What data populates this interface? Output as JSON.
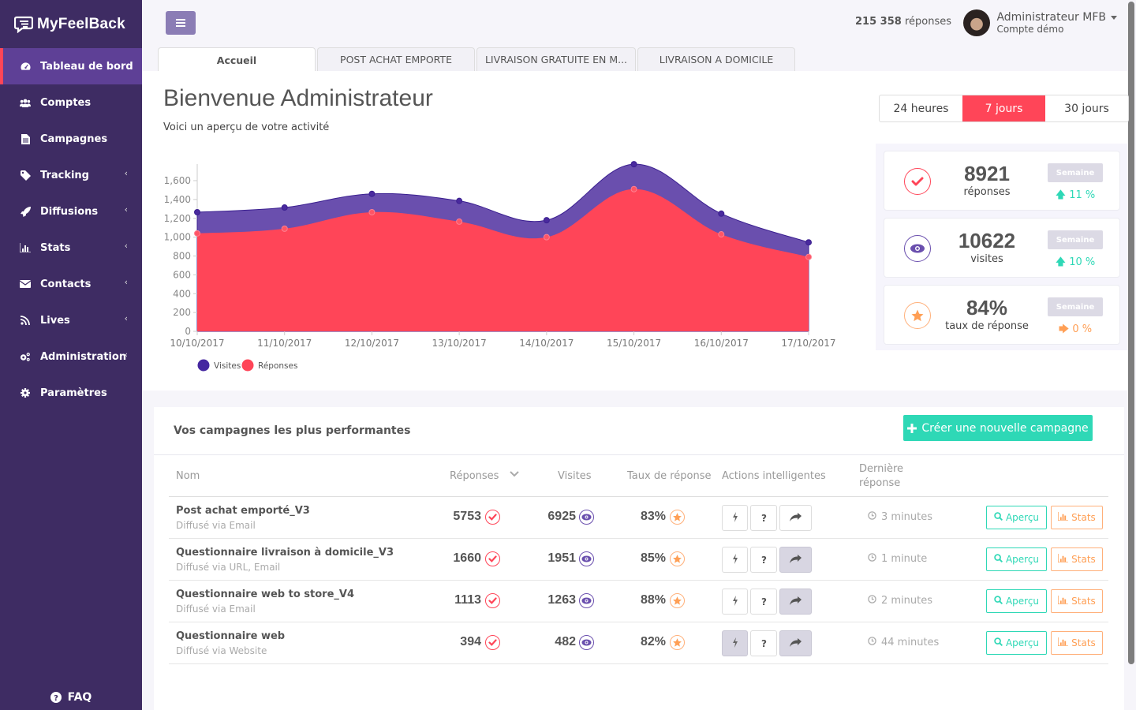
{
  "app": {
    "brand": "MyFeelBack"
  },
  "sidebar": {
    "items": [
      {
        "label": "Tableau de bord",
        "icon": "dashboard-icon",
        "active": true,
        "has_submenu": false
      },
      {
        "label": "Comptes",
        "icon": "users-icon",
        "has_submenu": false
      },
      {
        "label": "Campagnes",
        "icon": "file-icon",
        "has_submenu": false
      },
      {
        "label": "Tracking",
        "icon": "tag-icon",
        "has_submenu": true
      },
      {
        "label": "Diffusions",
        "icon": "rocket-icon",
        "has_submenu": true
      },
      {
        "label": "Stats",
        "icon": "bar-chart-icon",
        "has_submenu": true
      },
      {
        "label": "Contacts",
        "icon": "envelope-icon",
        "has_submenu": true
      },
      {
        "label": "Lives",
        "icon": "rss-icon",
        "has_submenu": true
      },
      {
        "label": "Administration",
        "icon": "cogs-icon",
        "has_submenu": true
      },
      {
        "label": "Paramètres",
        "icon": "gear-icon",
        "has_submenu": false
      }
    ],
    "chevron": "‹",
    "faq_label": "FAQ"
  },
  "header": {
    "responses_count": "215 358",
    "responses_label": "réponses",
    "user_name": "Administrateur MFB",
    "user_account": "Compte démo"
  },
  "tabs": [
    {
      "label": "Accueil",
      "active": true
    },
    {
      "label": "POST ACHAT EMPORTE"
    },
    {
      "label": "LIVRAISON GRATUITE EN M..."
    },
    {
      "label": "LIVRAISON A DOMICILE"
    }
  ],
  "welcome": {
    "title": "Bienvenue Administrateur",
    "subtitle": "Voici un aperçu de votre activité"
  },
  "period": {
    "options": [
      "24 heures",
      "7 jours",
      "30 jours"
    ],
    "selected": "7 jours"
  },
  "kpis": [
    {
      "value": "8921",
      "label": "réponses",
      "badge": "Semaine",
      "trend": "11 %",
      "trend_dir": "up",
      "icon": "check-circle-icon"
    },
    {
      "value": "10622",
      "label": "visites",
      "badge": "Semaine",
      "trend": "10 %",
      "trend_dir": "up",
      "icon": "eye-icon"
    },
    {
      "value": "84%",
      "label": "taux de réponse",
      "badge": "Semaine",
      "trend": "0 %",
      "trend_dir": "right",
      "icon": "star-icon"
    }
  ],
  "colors": {
    "accent": "#ff4558",
    "sidebar": "#3e2c63",
    "sidebar_active": "#5e4096",
    "visits": "#6a4fae",
    "responses": "#ff4558",
    "teal": "#2ed8b6",
    "orange": "#ff9f55"
  },
  "chart_data": {
    "type": "area",
    "categories": [
      "10/10/2017",
      "11/10/2017",
      "12/10/2017",
      "13/10/2017",
      "14/10/2017",
      "15/10/2017",
      "16/10/2017",
      "17/10/2017"
    ],
    "series": [
      {
        "name": "Visites",
        "color": "#6a4fae",
        "values": [
          1265,
          1315,
          1460,
          1385,
          1180,
          1775,
          1250,
          945
        ]
      },
      {
        "name": "Réponses",
        "color": "#ff4558",
        "values": [
          1040,
          1090,
          1265,
          1165,
          1000,
          1510,
          1030,
          790
        ]
      }
    ],
    "yticks": [
      0,
      200,
      400,
      600,
      800,
      1000,
      1200,
      1400,
      1600
    ],
    "ytick_labels": [
      "0",
      "200",
      "400",
      "600",
      "800",
      "1,000",
      "1,200",
      "1,400",
      "1,600"
    ],
    "ylim": [
      0,
      1760
    ],
    "legend": [
      "Visites",
      "Réponses"
    ],
    "legend_position": "bottom-left",
    "grid": false,
    "title": "",
    "xlabel": "",
    "ylabel": ""
  },
  "campaigns": {
    "title": "Vos campagnes les plus performantes",
    "create_label": "Créer une nouvelle campagne",
    "columns": {
      "name": "Nom",
      "responses": "Réponses",
      "visits": "Visites",
      "rate": "Taux de réponse",
      "actions": "Actions intelligentes",
      "last_line1": "Dernière",
      "last_line2": "réponse"
    },
    "preview_label": "Aperçu",
    "stats_label": "Stats",
    "rows": [
      {
        "name": "Post achat emporté_V3",
        "via": "Diffusé via Email",
        "responses": "5753",
        "visits": "6925",
        "rate": "83%",
        "last": "3 minutes",
        "actions_on": [
          false,
          false,
          false
        ]
      },
      {
        "name": "Questionnaire livraison à domicile_V3",
        "via": "Diffusé via URL, Email",
        "responses": "1660",
        "visits": "1951",
        "rate": "85%",
        "last": "1 minute",
        "actions_on": [
          false,
          false,
          true
        ]
      },
      {
        "name": "Questionnaire web to store_V4",
        "via": "Diffusé via Email",
        "responses": "1113",
        "visits": "1263",
        "rate": "88%",
        "last": "2 minutes",
        "actions_on": [
          false,
          false,
          true
        ]
      },
      {
        "name": "Questionnaire web",
        "via": "Diffusé via Website",
        "responses": "394",
        "visits": "482",
        "rate": "82%",
        "last": "44 minutes",
        "actions_on": [
          true,
          false,
          true
        ]
      }
    ]
  }
}
